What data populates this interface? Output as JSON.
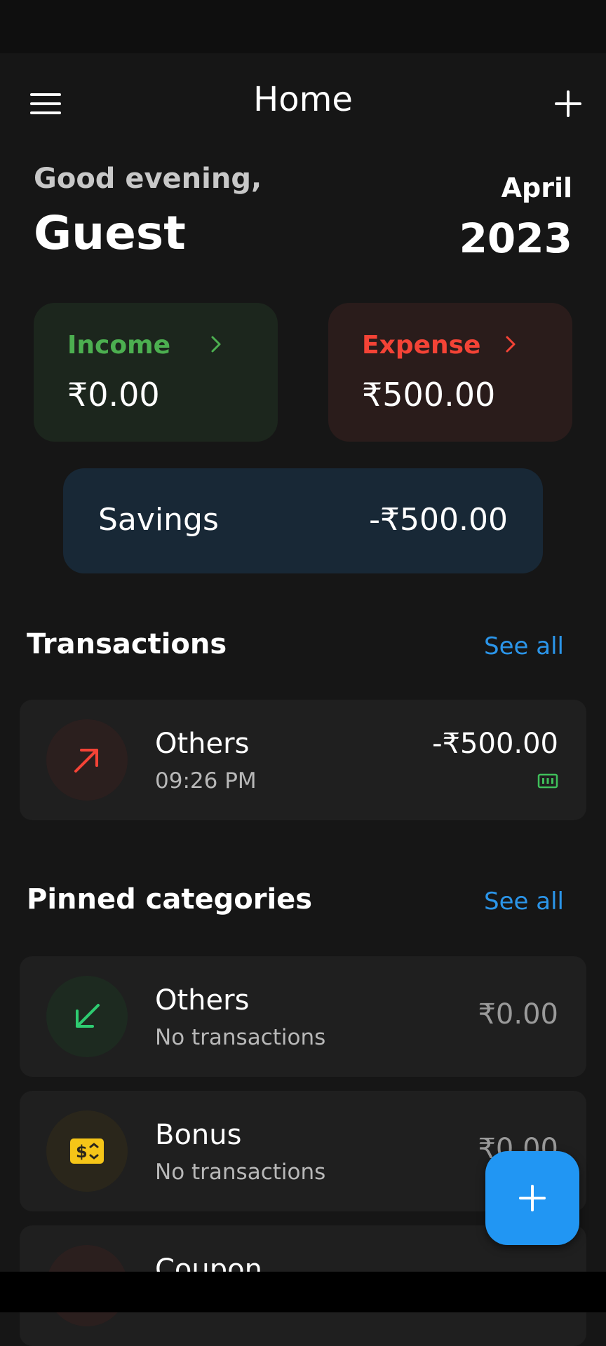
{
  "header": {
    "title": "Home"
  },
  "greeting": {
    "line": "Good evening,",
    "name": "Guest"
  },
  "period": {
    "month": "April",
    "year": "2023"
  },
  "income": {
    "label": "Income",
    "value": "₹0.00",
    "color": "#4caf50"
  },
  "expense": {
    "label": "Expense",
    "value": "₹500.00",
    "color": "#f44336"
  },
  "savings": {
    "label": "Savings",
    "value": "-₹500.00"
  },
  "transactions": {
    "title": "Transactions",
    "see_all": "See all",
    "items": [
      {
        "title": "Others",
        "time": "09:26 PM",
        "amount": "-₹500.00",
        "icon": "arrow-up-right-icon",
        "badge_icon": "cash-icon"
      }
    ]
  },
  "pinned": {
    "title": "Pinned categories",
    "see_all": "See all",
    "items": [
      {
        "title": "Others",
        "subtitle": "No transactions",
        "amount": "₹0.00",
        "icon": "arrow-down-left-icon"
      },
      {
        "title": "Bonus",
        "subtitle": "No transactions",
        "amount": "₹0.00",
        "icon": "money-icon"
      },
      {
        "title": "Coupon",
        "icon": "coupon-icon"
      }
    ]
  },
  "fab": {
    "icon": "plus-icon"
  }
}
